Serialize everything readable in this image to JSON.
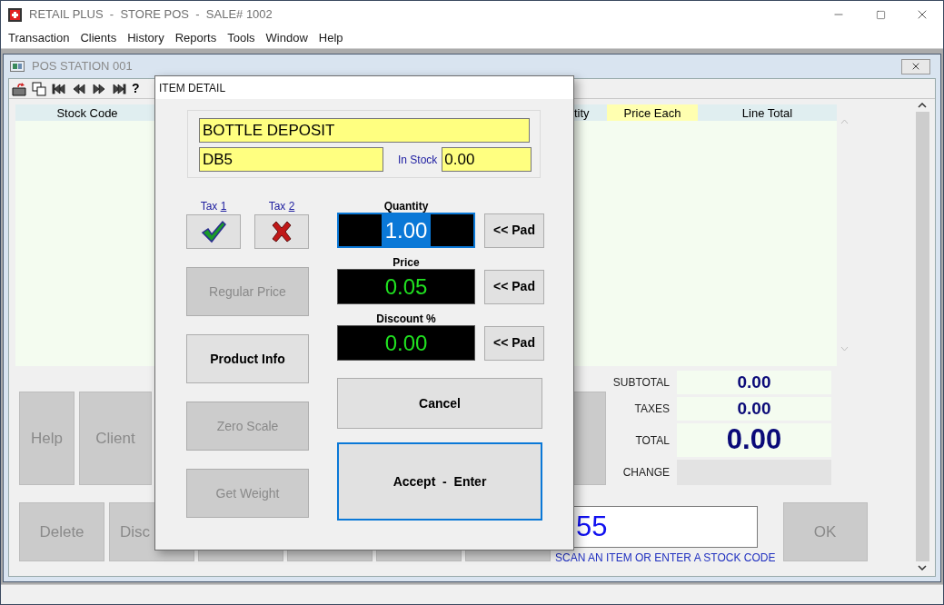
{
  "app": {
    "title": "RETAIL PLUS  -  STORE POS  -  SALE# 1002"
  },
  "menu": [
    {
      "label": "Transaction"
    },
    {
      "label": "Clients"
    },
    {
      "label": "History"
    },
    {
      "label": "Reports"
    },
    {
      "label": "Tools"
    },
    {
      "label": "Window"
    },
    {
      "label": "Help"
    }
  ],
  "pos_window": {
    "title": "POS STATION 001",
    "help_glyph": "?"
  },
  "sale_list": {
    "columns": [
      {
        "label": "Stock Code",
        "selected": false
      },
      {
        "label": "tity",
        "selected": false
      },
      {
        "label": "Price Each",
        "selected": true
      },
      {
        "label": "Line Total",
        "selected": false
      }
    ]
  },
  "totals": [
    {
      "label": "SUBTOTAL",
      "value": "0.00",
      "kind": "small"
    },
    {
      "label": "TAXES",
      "value": "0.00",
      "kind": "small"
    },
    {
      "label": "TOTAL",
      "value": "0.00",
      "kind": "large"
    },
    {
      "label": "CHANGE",
      "kind": "empty"
    }
  ],
  "function_buttons": {
    "row_1": [
      {
        "label": "Help",
        "disabled": true
      },
      {
        "label": "Client",
        "disabled": true
      },
      {
        "disabled": true
      }
    ],
    "row_2": [
      {
        "label": "Delete",
        "disabled": true
      },
      {
        "label": "Disc",
        "disabled": true
      },
      {
        "disabled": true
      },
      {
        "disabled": true
      },
      {
        "disabled": true
      },
      {
        "disabled": true
      }
    ]
  },
  "scan": {
    "value": "55",
    "hint": "SCAN AN ITEM OR ENTER A STOCK CODE"
  },
  "ok_button": {
    "label": "OK",
    "disabled": true
  },
  "dialog": {
    "title": "ITEM DETAIL",
    "description": "BOTTLE DEPOSIT",
    "stock_code": "DB5",
    "in_stock_label": "In Stock",
    "in_stock": "0.00",
    "taxes": [
      {
        "label": "Tax",
        "key": "1",
        "checked": true
      },
      {
        "label": "Tax",
        "key": "2",
        "checked": false
      }
    ],
    "side_buttons": [
      {
        "label": "Regular Price",
        "disabled": true
      },
      {
        "label": "Product Info",
        "disabled": false
      },
      {
        "label": "Zero Scale",
        "disabled": true
      },
      {
        "label": "Get Weight",
        "disabled": true
      }
    ],
    "entries": [
      {
        "label": "Quantity",
        "value": "1.00",
        "selected": true,
        "pad": "<< Pad"
      },
      {
        "label": "Price",
        "value": "0.05",
        "selected": false,
        "pad": "<< Pad"
      },
      {
        "label": "Discount %",
        "value": "0.00",
        "selected": false,
        "pad": "<< Pad"
      }
    ],
    "cancel": "Cancel",
    "accept": {
      "label": "Accept  -  Enter",
      "focused": true
    }
  }
}
